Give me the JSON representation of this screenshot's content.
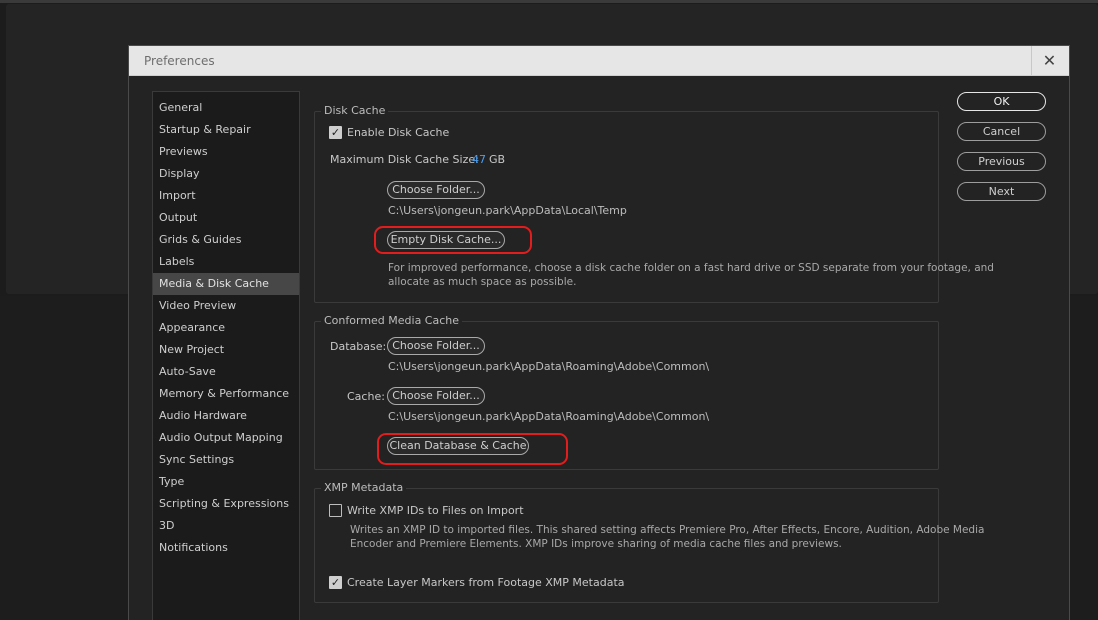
{
  "dialog": {
    "title": "Preferences",
    "close_glyph": "✕"
  },
  "sidebar": {
    "active": "Media & Disk Cache",
    "items": [
      {
        "label": "General"
      },
      {
        "label": "Startup & Repair"
      },
      {
        "label": "Previews"
      },
      {
        "label": "Display"
      },
      {
        "label": "Import"
      },
      {
        "label": "Output"
      },
      {
        "label": "Grids & Guides"
      },
      {
        "label": "Labels"
      },
      {
        "label": "Media & Disk Cache"
      },
      {
        "label": "Video Preview"
      },
      {
        "label": "Appearance"
      },
      {
        "label": "New Project"
      },
      {
        "label": "Auto-Save"
      },
      {
        "label": "Memory & Performance"
      },
      {
        "label": "Audio Hardware"
      },
      {
        "label": "Audio Output Mapping"
      },
      {
        "label": "Sync Settings"
      },
      {
        "label": "Type"
      },
      {
        "label": "Scripting & Expressions"
      },
      {
        "label": "3D"
      },
      {
        "label": "Notifications"
      }
    ]
  },
  "disk_cache": {
    "section_label": "Disk Cache",
    "enable_label": "Enable Disk Cache",
    "enable_checked": true,
    "max_size_label": "Maximum Disk Cache Size:",
    "max_size_value": "47",
    "max_size_unit": "GB",
    "choose_folder_label": "Choose Folder...",
    "folder_path": "C:\\Users\\jongeun.park\\AppData\\Local\\Temp",
    "empty_button_label": "Empty Disk Cache...",
    "info_line1": "For improved performance, choose a disk cache folder on a fast hard drive or SSD separate from your footage, and",
    "info_line2": "allocate as much space as possible."
  },
  "conformed_cache": {
    "section_label": "Conformed Media Cache",
    "database_label": "Database:",
    "database_button_label": "Choose Folder...",
    "database_path": "C:\\Users\\jongeun.park\\AppData\\Roaming\\Adobe\\Common\\",
    "cache_label": "Cache:",
    "cache_button_label": "Choose Folder...",
    "cache_path": "C:\\Users\\jongeun.park\\AppData\\Roaming\\Adobe\\Common\\",
    "clean_button_label": "Clean Database & Cache"
  },
  "xmp": {
    "section_label": "XMP Metadata",
    "write_ids_label": "Write XMP IDs to Files on Import",
    "write_ids_checked": false,
    "info_line1": "Writes an XMP ID to imported files. This shared setting affects Premiere Pro, After Effects, Encore, Audition, Adobe Media",
    "info_line2": "Encoder and Premiere Elements. XMP IDs improve sharing of media cache files and previews.",
    "layer_markers_label": "Create Layer Markers from Footage XMP Metadata",
    "layer_markers_checked": true
  },
  "actions": {
    "ok": "OK",
    "cancel": "Cancel",
    "previous": "Previous",
    "next": "Next"
  },
  "checkmark_glyph": "✓",
  "colors": {
    "accent_value": "#4c9ef0",
    "annotation": "#e11d1d"
  }
}
